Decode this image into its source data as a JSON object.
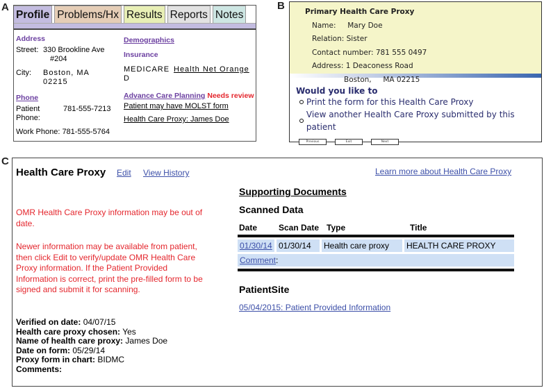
{
  "panel_labels": {
    "a": "A",
    "b": "B",
    "c": "C"
  },
  "panel_a": {
    "tabs": [
      {
        "label": "Profile",
        "color": "#c3bce0",
        "active": true
      },
      {
        "label": "Problems/Hx",
        "color": "#e5cdb6"
      },
      {
        "label": "Results",
        "color": "#e8efb5"
      },
      {
        "label": "Reports",
        "color": "#e2e2e2"
      },
      {
        "label": "Notes",
        "color": "#cde6e3"
      }
    ],
    "address": {
      "heading": "Address",
      "street_label": "Street:",
      "street_line1": "330 Brookline Ave",
      "street_line2": "#204",
      "city_label": "City:",
      "city_line1": "Boston, MA",
      "city_line2": "02215"
    },
    "phone": {
      "heading": "Phone",
      "patient_label_1": "Patient",
      "patient_label_2": "Phone:",
      "patient_value": "781-555-7213",
      "work": "Work Phone: 781-555-5764"
    },
    "demographics": {
      "heading": "Demographics"
    },
    "insurance": {
      "heading": "Insurance",
      "primary": "MEDICARE",
      "secondary_line1": "Health Net Orange",
      "secondary_line2": "D"
    },
    "advance_care": {
      "heading": "Advance Care Planning",
      "status": "Needs review",
      "molst": "Patient may have MOLST form",
      "proxy": "Health Care Proxy: James Doe"
    }
  },
  "panel_b": {
    "title": "Primary Health Care Proxy",
    "name": "Name:     Mary Doe",
    "relation": "Relation: Sister",
    "contact": "Contact number: 781 555 0497",
    "address_line1": "Address: 1 Deaconess Road",
    "address_line2": "Boston,     MA 02215",
    "question": "Would you like to",
    "options": [
      "Print the form for this Health Care Proxy",
      "View another Health Care Proxy submitted by this patient"
    ],
    "buttons": {
      "previous": "Previous",
      "exit": "Exit",
      "next": "Next"
    }
  },
  "panel_c": {
    "title": "Health Care Proxy",
    "edit_link": "Edit",
    "history_link": "View History",
    "learn_more_link": "Learn more about Health Care Proxy",
    "warning_1": "OMR Health Care Proxy information may be out of date.",
    "warning_2": "Newer information may be available from patient, then click Edit to verify/update OMR Health Care Proxy information. If the Patient Provided Information is correct, print the pre-filled form to be signed and submit it for scanning.",
    "fields": [
      {
        "label": "Verified on date:",
        "value": "04/07/15"
      },
      {
        "label": "Health care proxy chosen:",
        "value": "Yes"
      },
      {
        "label": "Name of health care proxy:",
        "value": "James Doe"
      },
      {
        "label": "Date on form:",
        "value": "05/29/14"
      },
      {
        "label": "Proxy form in chart:",
        "value": "BIDMC"
      },
      {
        "label": "Comments:",
        "value": ""
      }
    ],
    "supporting_documents": "Supporting Documents",
    "scanned_data": "Scanned Data",
    "columns": [
      "Date",
      "Scan Date",
      "Type",
      "Title"
    ],
    "rows": [
      {
        "date": "01/30/14",
        "scan_date": "01/30/14",
        "type": "Health care proxy",
        "title": "HEALTH CARE PROXY"
      }
    ],
    "comment_link": "Comment",
    "comment_suffix": ":",
    "patientsite_heading": "PatientSite",
    "patientsite_link": "05/04/2015: Patient Provided Information"
  }
}
